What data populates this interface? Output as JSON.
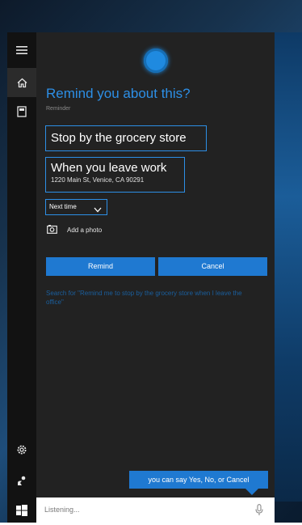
{
  "cortana": {
    "question": "Remind you about this?",
    "section_label": "Reminder",
    "reminder_text": "Stop by the grocery store",
    "location_title": "When you leave work",
    "location_address": "1220 Main St, Venice, CA 90291",
    "timing_option": "Next time",
    "add_photo_label": "Add a photo",
    "remind_button": "Remind",
    "cancel_button": "Cancel",
    "suggestion_text": "Search for \"Remind me to stop by the grocery store when I leave the office\"",
    "speech_hint": "you can say Yes, No, or Cancel",
    "search_status": "Listening..."
  },
  "sidebar": {
    "items": [
      {
        "icon": "hamburger-menu-icon"
      },
      {
        "icon": "home-icon"
      },
      {
        "icon": "notebook-icon"
      },
      {
        "icon": "settings-gear-icon"
      },
      {
        "icon": "feedback-icon"
      },
      {
        "icon": "windows-start-icon"
      }
    ]
  },
  "colors": {
    "accent": "#2d8fe6",
    "button": "#1f79d1",
    "panel": "#222222",
    "rail": "#121212"
  }
}
